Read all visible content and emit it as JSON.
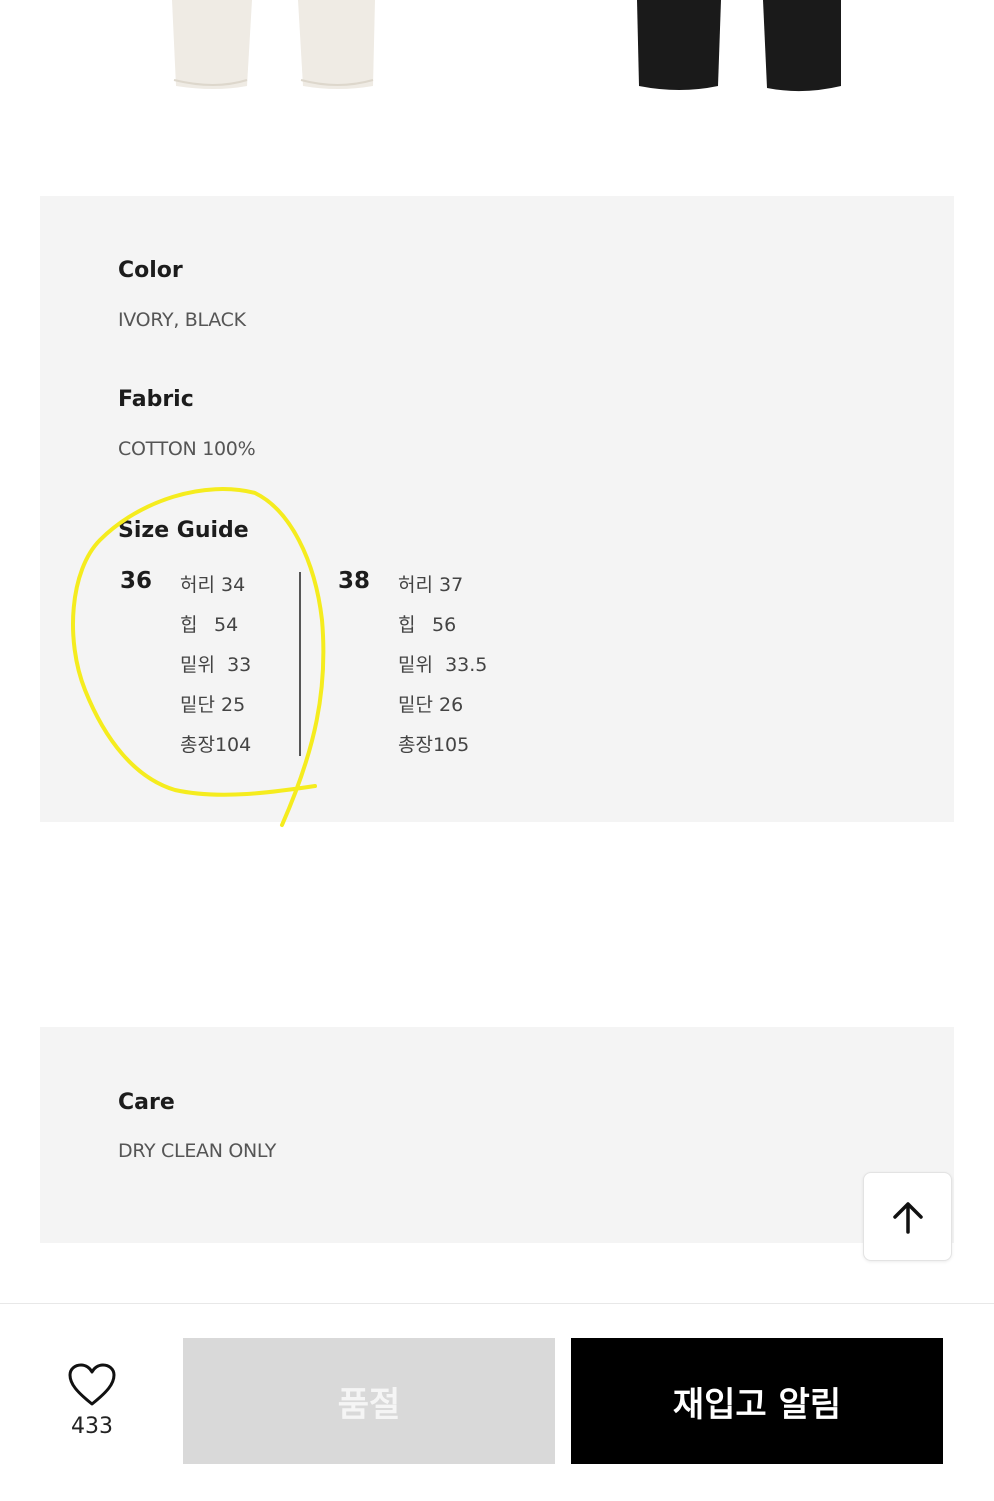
{
  "product": {
    "colors_swatches": [
      "#efebe4",
      "#1a1a1a"
    ]
  },
  "details": {
    "color": {
      "heading": "Color",
      "value": "IVORY, BLACK"
    },
    "fabric": {
      "heading": "Fabric",
      "value": "COTTON 100%"
    },
    "size_guide": {
      "heading": "Size Guide",
      "sizes": [
        {
          "size": "36",
          "measurements": [
            {
              "label": "허리",
              "value": "34"
            },
            {
              "label": "힙",
              "value": "54"
            },
            {
              "label": "밑위",
              "value": "33"
            },
            {
              "label": "밑단",
              "value": "25"
            },
            {
              "label": "총장",
              "value": "104"
            }
          ]
        },
        {
          "size": "38",
          "measurements": [
            {
              "label": "허리",
              "value": "37"
            },
            {
              "label": "힙",
              "value": "56"
            },
            {
              "label": "밑위",
              "value": "33.5"
            },
            {
              "label": "밑단",
              "value": "26"
            },
            {
              "label": "총장",
              "value": "105"
            }
          ]
        }
      ],
      "highlight_color": "#f5ec1e"
    },
    "care": {
      "heading": "Care",
      "value": "DRY CLEAN ONLY"
    }
  },
  "scroll_top": {
    "icon": "arrow-up-icon"
  },
  "bottom_bar": {
    "wishlist_icon": "heart-outline-icon",
    "wishlist_count": "433",
    "soldout_label": "품절",
    "restock_label": "재입고 알림"
  }
}
